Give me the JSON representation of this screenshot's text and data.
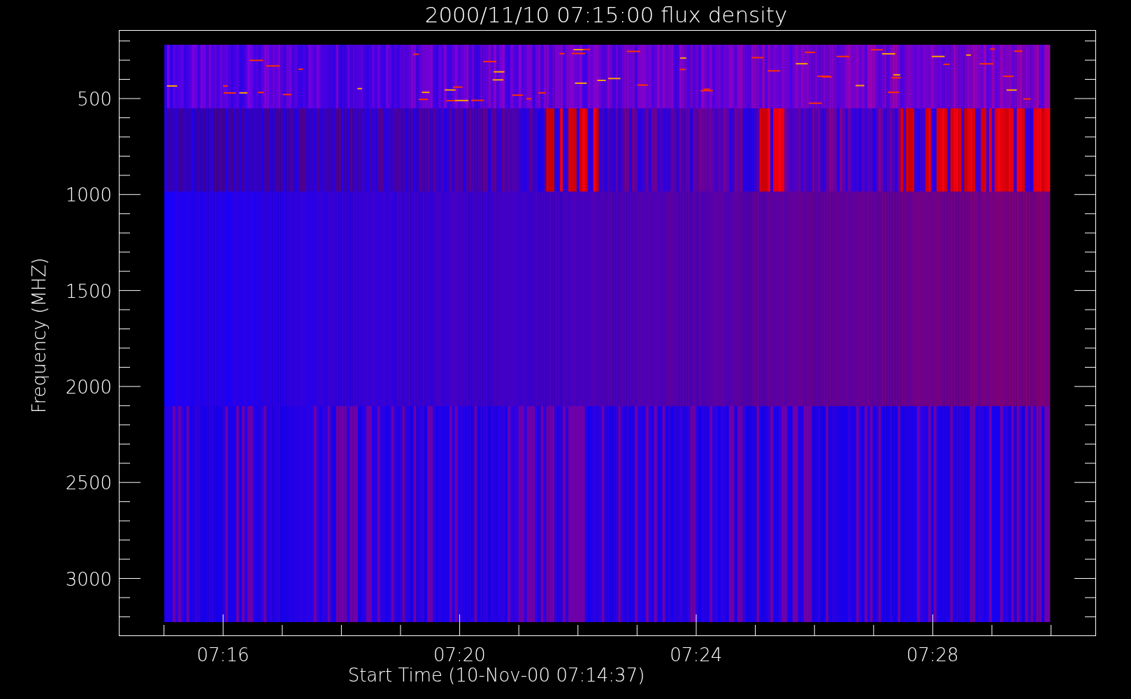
{
  "plot": {
    "title": "2000/11/10 07:15:00 flux density",
    "ylabel": "Frequency (MHZ)",
    "xlabel": "Start Time (10-Nov-00 07:14:37)",
    "yticks": [
      "500",
      "1000",
      "1500",
      "2000",
      "2500",
      "3000"
    ],
    "xticks": [
      "07:16",
      "07:20",
      "07:24",
      "07:28"
    ]
  }
}
